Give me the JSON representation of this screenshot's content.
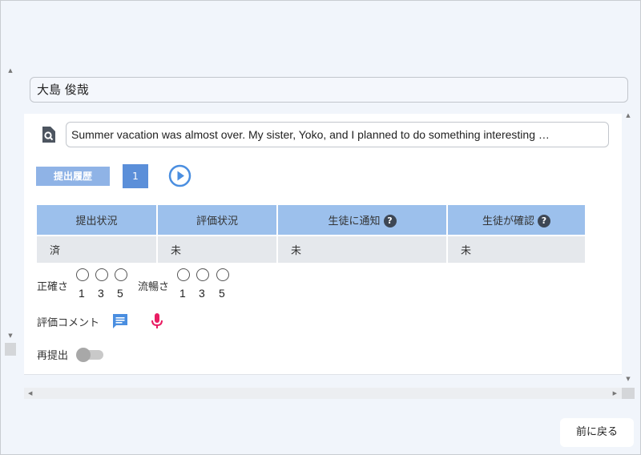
{
  "student": {
    "name": "大島 俊哉"
  },
  "answer": {
    "text": "Summer vacation was almost over. My sister, Yoko, and I planned to do something interesting …"
  },
  "history": {
    "label": "提出履歴",
    "number": "1"
  },
  "status_table": {
    "headers": [
      "提出状況",
      "評価状況",
      "生徒に通知",
      "生徒が確認"
    ],
    "help_icon": "?",
    "values": [
      "済",
      "未",
      "未",
      "未"
    ]
  },
  "ratings": {
    "accuracy": {
      "label": "正確さ",
      "options": [
        "1",
        "3",
        "5"
      ]
    },
    "fluency": {
      "label": "流暢さ",
      "options": [
        "1",
        "3",
        "5"
      ]
    }
  },
  "comment": {
    "label": "評価コメント",
    "comment_icon": "comment-icon",
    "mic_icon": "microphone-icon"
  },
  "resubmit": {
    "label": "再提出",
    "enabled": false
  },
  "footer": {
    "back_label": "前に戻る"
  },
  "colors": {
    "accent": "#5b8fd9",
    "header_bg": "#9cc0ec",
    "mic": "#e91e63",
    "comment": "#4a8ee0"
  }
}
